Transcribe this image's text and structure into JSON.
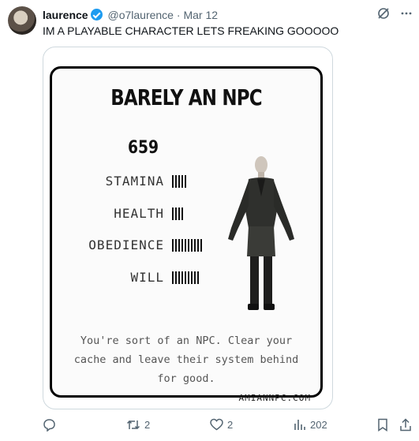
{
  "tweet": {
    "author_name": "laurence",
    "author_handle": "@o7laurence",
    "separator": "·",
    "date": "Mar 12",
    "text": "IM A PLAYABLE CHARACTER LETS FREAKING GOOOOO"
  },
  "card": {
    "title": "BARELY AN NPC",
    "score": "659",
    "stats": [
      {
        "label": "STAMINA",
        "level": 5
      },
      {
        "label": "HEALTH",
        "level": 4
      },
      {
        "label": "OBEDIENCE",
        "level": 10
      },
      {
        "label": "WILL",
        "level": 9
      }
    ],
    "caption_lines": [
      "You're sort of an NPC. Clear your",
      "cache and leave their system behind",
      "for good."
    ],
    "site": "AMIANNPC.COM"
  },
  "actions": {
    "retweets": "2",
    "likes": "2",
    "views": "202"
  },
  "icons": [
    "grok-icon",
    "more-icon",
    "reply-icon",
    "retweet-icon",
    "like-icon",
    "views-icon",
    "bookmark-icon",
    "share-icon"
  ],
  "colors": {
    "accent": "#1d9bf0",
    "muted": "#536471",
    "border": "#cfd9de"
  }
}
